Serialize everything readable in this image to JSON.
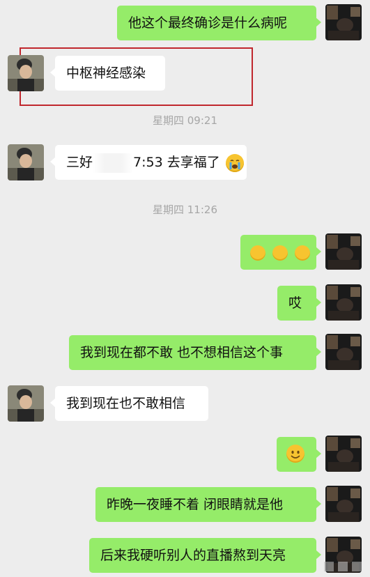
{
  "messages": [
    {
      "side": "right",
      "text": "他这个最终确诊是什么病呢"
    },
    {
      "side": "left",
      "text": "中枢神经感染"
    },
    {
      "timestamp": "星期四 09:21"
    },
    {
      "side": "left",
      "text_before": "三好",
      "text_after": "7:53 去享福了",
      "emoji": "crying-face"
    },
    {
      "timestamp": "星期四 11:26"
    },
    {
      "side": "right",
      "emoji": "hugging-face x3"
    },
    {
      "side": "right",
      "text": "哎"
    },
    {
      "side": "right",
      "text": "我到现在都不敢 也不想相信这个事"
    },
    {
      "side": "left",
      "text": "我到现在也不敢相信"
    },
    {
      "side": "right",
      "emoji": "smiling-face"
    },
    {
      "side": "right",
      "text": "昨晚一夜睡不着 闭眼睛就是他"
    },
    {
      "side": "right",
      "text": "后来我硬听别人的直播熬到天亮"
    }
  ],
  "colors": {
    "self_bubble": "#95ec69",
    "other_bubble": "#ffffff",
    "highlight": "#c0272d",
    "background": "#ededed"
  }
}
